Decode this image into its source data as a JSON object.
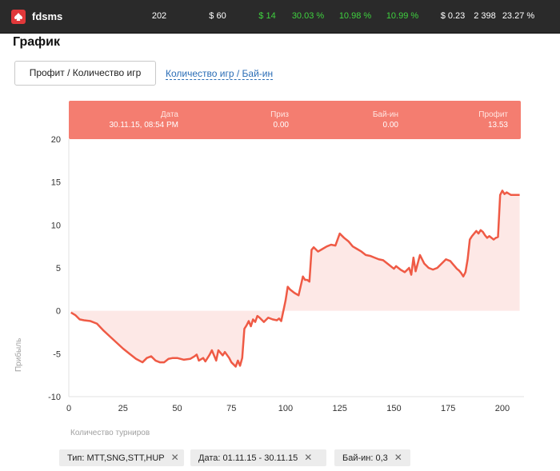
{
  "topbar": {
    "player_name": "fdsms",
    "stats": [
      {
        "value": "202",
        "color": "white"
      },
      {
        "value": "$ 60",
        "color": "white"
      },
      {
        "value": "$ 14",
        "color": "green"
      },
      {
        "value": "30.03 %",
        "color": "green"
      },
      {
        "value": "10.98 %",
        "color": "green"
      },
      {
        "value": "10.99 %",
        "color": "green"
      },
      {
        "value": "$ 0.23",
        "color": "white"
      },
      {
        "value": "2 398",
        "color": "white"
      },
      {
        "value": "23.27 %",
        "color": "white"
      }
    ]
  },
  "page": {
    "title": "График"
  },
  "tabs": {
    "active": "Профит / Количество игр",
    "other": "Количество игр / Бай-ин"
  },
  "tooltip": {
    "date_label": "Дата",
    "date_value": "30.11.15, 08:54 PM",
    "prize_label": "Приз",
    "prize_value": "0.00",
    "buyin_label": "Бай-ин",
    "buyin_value": "0.00",
    "profit_label": "Профит",
    "profit_value": "13.53"
  },
  "chart_data": {
    "type": "area",
    "xlabel": "Количество турниров",
    "ylabel": "Прибыль",
    "xlim": [
      0,
      210
    ],
    "ylim": [
      -10,
      20
    ],
    "x_ticks": [
      0,
      25,
      50,
      75,
      100,
      125,
      150,
      175,
      200
    ],
    "y_ticks": [
      20,
      15,
      10,
      5,
      0,
      -5,
      -10
    ],
    "colors": {
      "line": "#ef5a45",
      "fill": "#fde8e6"
    },
    "series": [
      {
        "x": [
          1,
          3,
          5,
          7,
          10,
          13,
          16,
          19,
          22,
          25,
          28,
          31,
          34,
          36,
          38,
          40,
          42,
          44,
          46,
          48,
          50,
          53,
          56,
          58,
          59,
          60,
          62,
          63,
          65,
          66,
          68,
          69,
          71,
          72,
          74,
          75,
          77,
          78,
          79,
          80,
          81,
          82,
          83,
          84,
          85,
          86,
          87,
          88,
          90,
          92,
          94,
          96,
          97,
          98,
          100,
          101,
          102,
          103,
          104,
          106,
          108,
          109,
          110,
          111,
          112,
          113,
          115,
          117,
          119,
          121,
          123,
          125,
          127,
          129,
          131,
          133,
          135,
          137,
          139,
          141,
          143,
          145,
          147,
          149,
          150,
          151,
          153,
          155,
          157,
          158,
          159,
          160,
          162,
          164,
          166,
          168,
          170,
          172,
          174,
          176,
          177,
          178,
          179,
          180,
          181,
          182,
          183,
          184,
          185,
          186,
          187,
          188,
          189,
          190,
          191,
          192,
          193,
          194,
          196,
          197,
          198,
          199,
          200,
          201,
          202,
          204,
          206,
          208
        ],
        "y": [
          -0.2,
          -0.5,
          -1.0,
          -1.1,
          -1.2,
          -1.5,
          -2.3,
          -3.0,
          -3.7,
          -4.4,
          -5.0,
          -5.6,
          -6.0,
          -5.5,
          -5.3,
          -5.8,
          -6.0,
          -6.0,
          -5.6,
          -5.5,
          -5.5,
          -5.7,
          -5.6,
          -5.3,
          -5.1,
          -5.8,
          -5.5,
          -5.9,
          -5.1,
          -4.6,
          -5.8,
          -4.6,
          -5.2,
          -4.8,
          -5.5,
          -6.0,
          -6.5,
          -5.8,
          -6.4,
          -5.5,
          -2.1,
          -1.7,
          -1.2,
          -1.8,
          -1.0,
          -1.3,
          -0.6,
          -0.8,
          -1.3,
          -0.8,
          -1.0,
          -1.1,
          -0.9,
          -1.2,
          1.2,
          2.8,
          2.5,
          2.3,
          2.1,
          1.8,
          4.0,
          3.6,
          3.6,
          3.4,
          7.1,
          7.4,
          6.9,
          7.2,
          7.5,
          7.7,
          7.6,
          9.0,
          8.5,
          8.1,
          7.5,
          7.2,
          6.9,
          6.5,
          6.4,
          6.2,
          6.0,
          5.9,
          5.5,
          5.1,
          4.9,
          5.2,
          4.8,
          4.5,
          5.0,
          4.2,
          6.2,
          4.6,
          6.5,
          5.5,
          5.0,
          4.8,
          5.0,
          5.5,
          6.0,
          5.8,
          5.5,
          5.2,
          4.9,
          4.7,
          4.4,
          4.0,
          4.5,
          6.0,
          8.3,
          8.7,
          9.0,
          9.3,
          9.0,
          9.4,
          9.2,
          8.8,
          8.5,
          8.7,
          8.3,
          8.5,
          8.6,
          13.5,
          14.0,
          13.6,
          13.8,
          13.5,
          13.5,
          13.5
        ]
      }
    ]
  },
  "filters": [
    {
      "label": "Тип: MTT,SNG,STT,HUP"
    },
    {
      "label": "Дата: 01.11.15 - 30.11.15"
    },
    {
      "label": "Бай-ин: 0,3"
    }
  ]
}
